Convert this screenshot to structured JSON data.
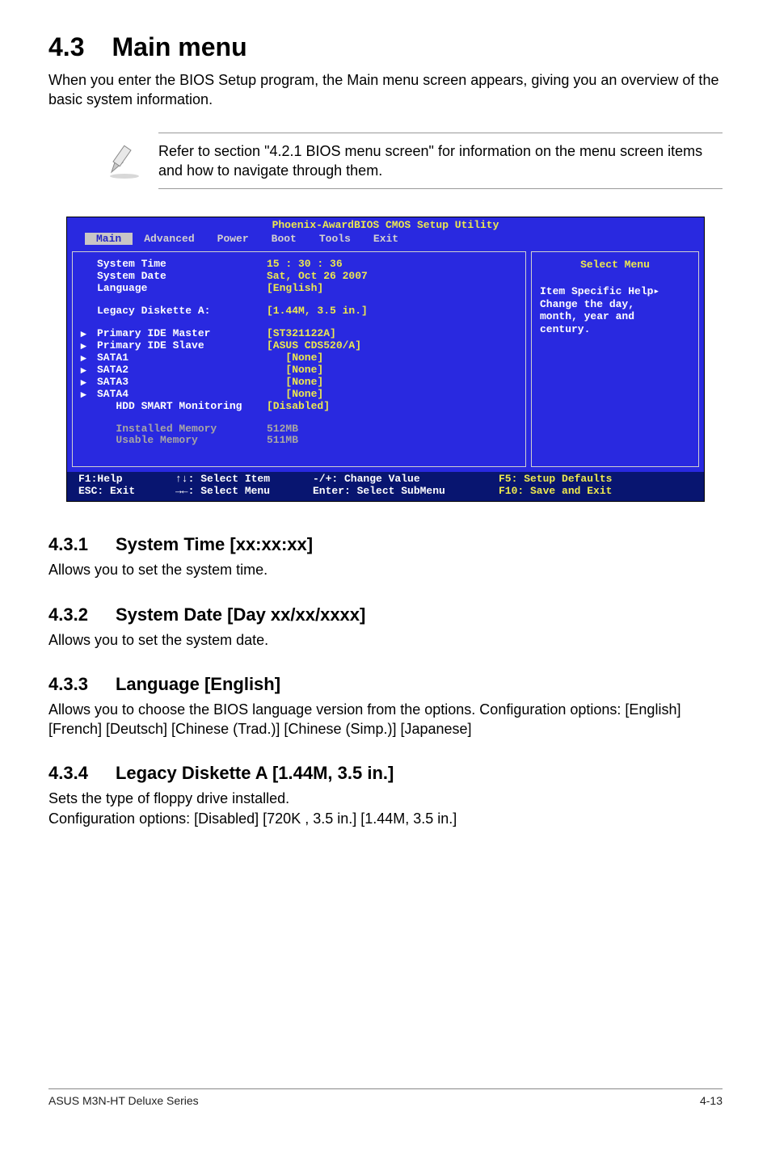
{
  "section": {
    "number": "4.3",
    "title": "Main menu",
    "intro": "When you enter the BIOS Setup program, the Main menu screen appears, giving you an overview of the basic system information.",
    "note": "Refer to section \"4.2.1 BIOS menu screen\" for information on the menu screen items and how to navigate through them."
  },
  "bios": {
    "title": "Phoenix-AwardBIOS CMOS Setup Utility",
    "tabs": [
      "Main",
      "Advanced",
      "Power",
      "Boot",
      "Tools",
      "Exit"
    ],
    "active_tab": "Main",
    "rows": [
      {
        "label": "System Time",
        "value": "15 : 30 : 36",
        "hl": true
      },
      {
        "label": "System Date",
        "value": "Sat, Oct 26 2007",
        "hl": true
      },
      {
        "label": "Language",
        "value": "[English]",
        "hl": true
      },
      {
        "spacer": true
      },
      {
        "label": "Legacy Diskette A:",
        "value": "[1.44M, 3.5 in.]",
        "hl": true
      },
      {
        "spacer": true
      },
      {
        "arrow": true,
        "label": "Primary IDE Master",
        "value": "[ST321122A]",
        "hl": true
      },
      {
        "arrow": true,
        "label": "Primary IDE Slave",
        "value": "[ASUS CDS520/A]",
        "hl": true
      },
      {
        "arrow": true,
        "label": "SATA1",
        "value": "   [None]",
        "hl": true
      },
      {
        "arrow": true,
        "label": "SATA2",
        "value": "   [None]",
        "hl": true
      },
      {
        "arrow": true,
        "label": "SATA3",
        "value": "   [None]",
        "hl": true
      },
      {
        "arrow": true,
        "label": "SATA4",
        "value": "   [None]",
        "hl": true
      },
      {
        "label": "   HDD SMART Monitoring",
        "value": "[Disabled]",
        "hl": true
      },
      {
        "spacer": true
      },
      {
        "label": "   Installed Memory",
        "value": "512MB",
        "dim": true
      },
      {
        "label": "   Usable Memory",
        "value": "511MB",
        "dim": true
      }
    ],
    "help_title": "Select Menu",
    "help_body": "Item Specific Help▸\nChange the day,\nmonth, year and\ncentury.",
    "footer": {
      "line1": {
        "k1": "F1:Help",
        "k2": "↑↓: Select Item",
        "k3": "-/+: Change Value",
        "k4": "F5: Setup Defaults"
      },
      "line2": {
        "k1": "ESC: Exit",
        "k2": "→←: Select Menu",
        "k3": "Enter: Select SubMenu",
        "k4": "F10: Save and Exit"
      }
    }
  },
  "subsections": [
    {
      "num": "4.3.1",
      "title": "System Time [xx:xx:xx]",
      "body": "Allows you to set the system time."
    },
    {
      "num": "4.3.2",
      "title": "System Date [Day xx/xx/xxxx]",
      "body": "Allows you to set the system date."
    },
    {
      "num": "4.3.3",
      "title": "Language [English]",
      "body": "Allows you to choose the BIOS language version from the options. Configuration options: [English] [French] [Deutsch] [Chinese (Trad.)] [Chinese (Simp.)] [Japanese]"
    },
    {
      "num": "4.3.4",
      "title": "Legacy Diskette A [1.44M, 3.5 in.]",
      "body": "Sets the type of floppy drive installed.\nConfiguration options: [Disabled] [720K , 3.5 in.] [1.44M, 3.5 in.]"
    }
  ],
  "footer": {
    "left": "ASUS M3N-HT Deluxe Series",
    "right": "4-13"
  }
}
